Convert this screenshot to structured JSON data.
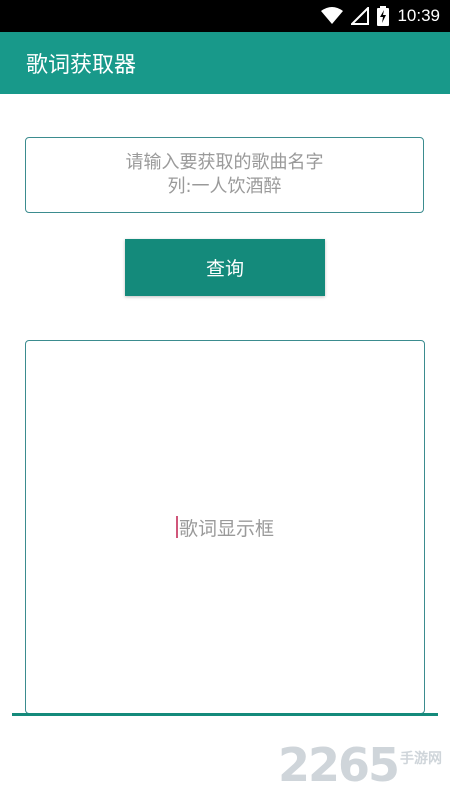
{
  "status_bar": {
    "time": "10:39"
  },
  "app_bar": {
    "title": "歌词获取器"
  },
  "search": {
    "placeholder_line1": "请输入要获取的歌曲名字",
    "placeholder_line2": "列:一人饮酒醉"
  },
  "query_button": {
    "label": "查询"
  },
  "lyrics": {
    "placeholder": "歌词显示框"
  },
  "watermark": {
    "number": "2265",
    "text": "手游网"
  },
  "colors": {
    "primary": "#18998a",
    "button": "#148a7b",
    "border": "#3b8c8f",
    "hint": "#9a9a9a"
  }
}
